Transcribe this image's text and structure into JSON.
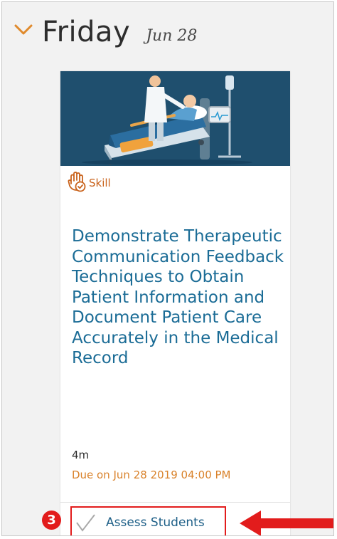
{
  "day": {
    "name": "Friday",
    "date": "Jun 28"
  },
  "card": {
    "badge_label": "Skill",
    "title": "Demonstrate Therapeutic Communication Feedback Techniques to Obtain Patient Information and Document Patient Care Accurately in the Medical Record",
    "duration": "4m",
    "due": "Due on Jun 28 2019 04:00 PM"
  },
  "action": {
    "label": "Assess Students",
    "step_number": "3"
  },
  "colors": {
    "accent_orange": "#c9621b",
    "title_blue": "#1b6c96",
    "due_orange": "#d9822b",
    "callout_red": "#e21c1c"
  },
  "icons": {
    "collapse": "chevron-down-icon",
    "skill": "hand-check-icon",
    "checkmark": "check-icon",
    "callout": "arrow-left-icon"
  }
}
